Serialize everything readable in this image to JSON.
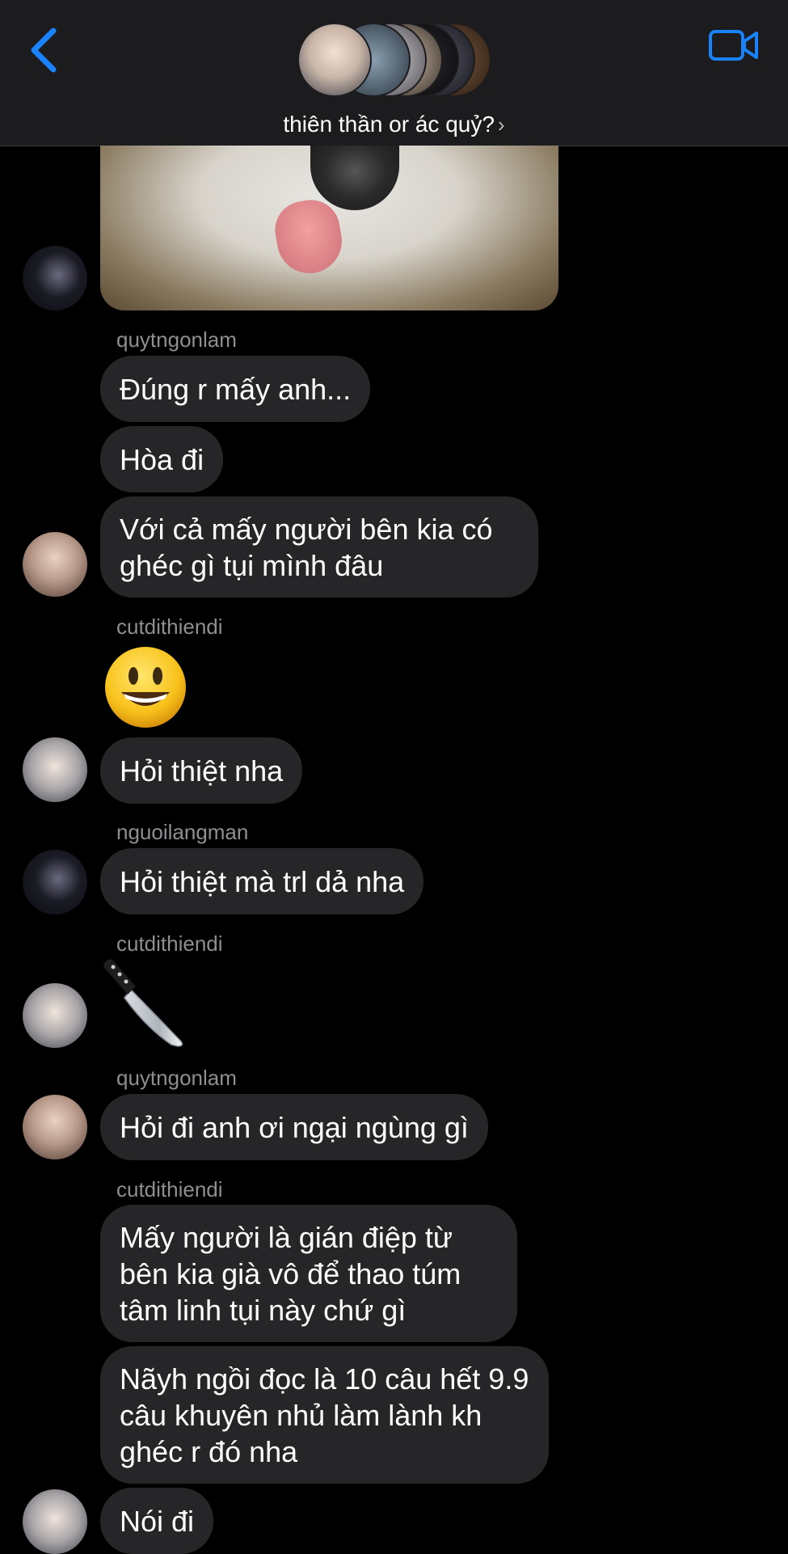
{
  "header": {
    "group_name": "thiên thần or ác quỷ?",
    "back_icon": "chevron-left-icon",
    "video_icon": "video-camera-icon",
    "accent_color": "#1a82fb"
  },
  "messages": [
    {
      "type": "sender",
      "text": "quytngonlam"
    },
    {
      "type": "text",
      "text": "Đúng r mấy anh..."
    },
    {
      "type": "text",
      "text": "Hòa đi"
    },
    {
      "type": "text",
      "text": "Với cả mấy người bên kia có ghéc gì tụi mình đâu"
    },
    {
      "type": "sender",
      "text": "cutdithiendi"
    },
    {
      "type": "emoji",
      "icon": "grinning-face-emoji"
    },
    {
      "type": "text",
      "text": "Hỏi thiệt nha"
    },
    {
      "type": "sender",
      "text": "nguoilangman"
    },
    {
      "type": "text",
      "text": "Hỏi thiệt mà trl dả nha"
    },
    {
      "type": "sender",
      "text": "cutdithiendi"
    },
    {
      "type": "emoji",
      "icon": "knife-emoji"
    },
    {
      "type": "sender",
      "text": "quytngonlam"
    },
    {
      "type": "text",
      "text": "Hỏi đi anh ơi ngại ngùng gì"
    },
    {
      "type": "sender",
      "text": "cutdithiendi"
    },
    {
      "type": "text",
      "text": "Mấy người là gián điệp từ bên kia già vô để thao túm tâm linh tụi này chứ gì"
    },
    {
      "type": "text",
      "text": "Nãyh ngồi đọc là 10 câu hết 9.9 câu khuyên nhủ làm lành kh ghéc r đó nha"
    },
    {
      "type": "text",
      "text": "Nói đi"
    }
  ]
}
